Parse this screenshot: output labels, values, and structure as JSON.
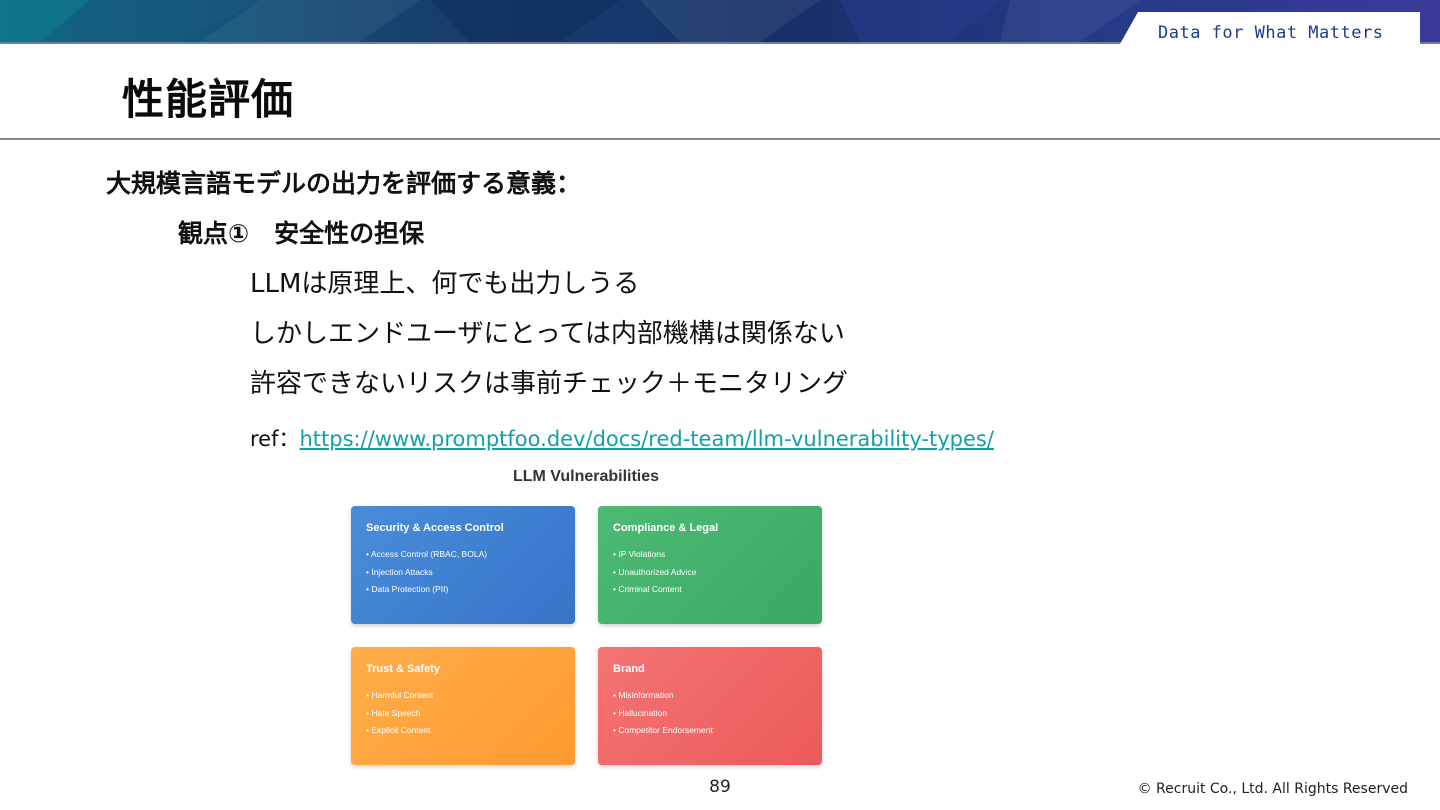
{
  "header": {
    "tagline": "Data for What Matters",
    "brand_colors": {
      "banner_left": "#0f6a83",
      "banner_mid": "#16306a",
      "banner_right": "#3b3a9a",
      "tagline": "#1a3d86"
    }
  },
  "slide": {
    "title": "性能評価",
    "heading": "大規模言語モデルの出力を評価する意義：",
    "subheading": "観点①　安全性の担保",
    "bullets": [
      "LLMは原理上、何でも出力しうる",
      "しかしエンドユーザにとっては内部機構は関係ない",
      "許容できないリスクは事前チェック＋モニタリング"
    ],
    "ref_label": "ref：",
    "ref_link": "https://www.promptfoo.dev/docs/red-team/llm-vulnerability-types/"
  },
  "figure": {
    "title": "LLM Vulnerabilities",
    "cards": [
      {
        "title": "Security & Access Control",
        "color": "#3f80d2",
        "items": [
          "• Access Control (RBAC, BOLA)",
          "• Injection Attacks",
          "• Data Protection (PII)"
        ]
      },
      {
        "title": "Compliance & Legal",
        "color": "#44b26c",
        "items": [
          "• IP Violations",
          "• Unauthorized Advice",
          "• Criminal Content"
        ]
      },
      {
        "title": "Trust & Safety",
        "color": "#ffa43c",
        "items": [
          "• Harmful Content",
          "• Hate Speech",
          "• Explicit Content"
        ]
      },
      {
        "title": "Brand",
        "color": "#f06666",
        "items": [
          "• Misinformation",
          "• Hallucination",
          "• Competitor Endorsement"
        ]
      }
    ]
  },
  "footer": {
    "page_number": "89",
    "copyright": "© Recruit Co., Ltd. All Rights Reserved"
  }
}
